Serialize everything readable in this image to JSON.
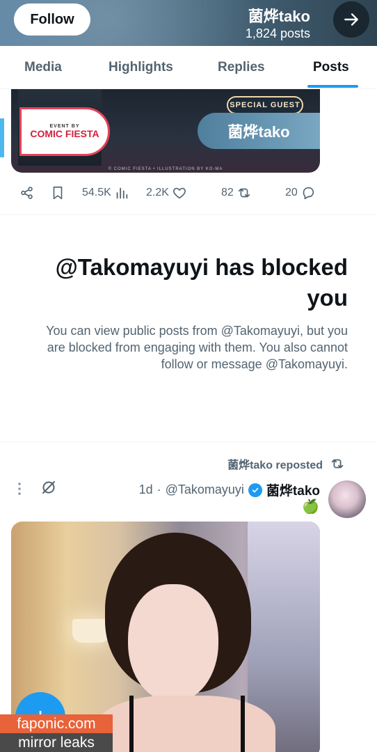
{
  "header": {
    "follow_label": "Follow",
    "profile_name": "菌烨tako",
    "posts_count": "1,824 posts"
  },
  "tabs": [
    {
      "label": "Posts",
      "active": true
    },
    {
      "label": "Replies",
      "active": false
    },
    {
      "label": "Highlights",
      "active": false
    },
    {
      "label": "Media",
      "active": false
    }
  ],
  "card": {
    "event_by": "EVENT BY",
    "event_name": "COMIC FIESTA",
    "special_guest": "SPECIAL GUEST",
    "guest_name": "菌烨tako",
    "credit": "© COMIC FIESTA • ILLUSTRATION BY KO-MA"
  },
  "post_actions": {
    "replies": "20",
    "reposts": "82",
    "likes": "2.2K",
    "views": "54.5K"
  },
  "blocked": {
    "title": "@Takomayuyi has blocked you",
    "description": "You can view public posts from @Takomayuyi, but you are blocked from engaging with them. You also cannot follow or message @Takomayuyi."
  },
  "repost": {
    "reposted_by": "菌烨tako reposted",
    "author": "菌烨tako",
    "handle": "@Takomayuyi",
    "time": "1d",
    "separator": "·",
    "emoji": "🍏"
  },
  "watermark": {
    "line1": "faponic.com",
    "line2": "mirror leaks"
  },
  "colors": {
    "accent": "#1d9bf0",
    "text_primary": "#0f1419",
    "text_secondary": "#536471",
    "watermark_orange": "#e8623a"
  }
}
